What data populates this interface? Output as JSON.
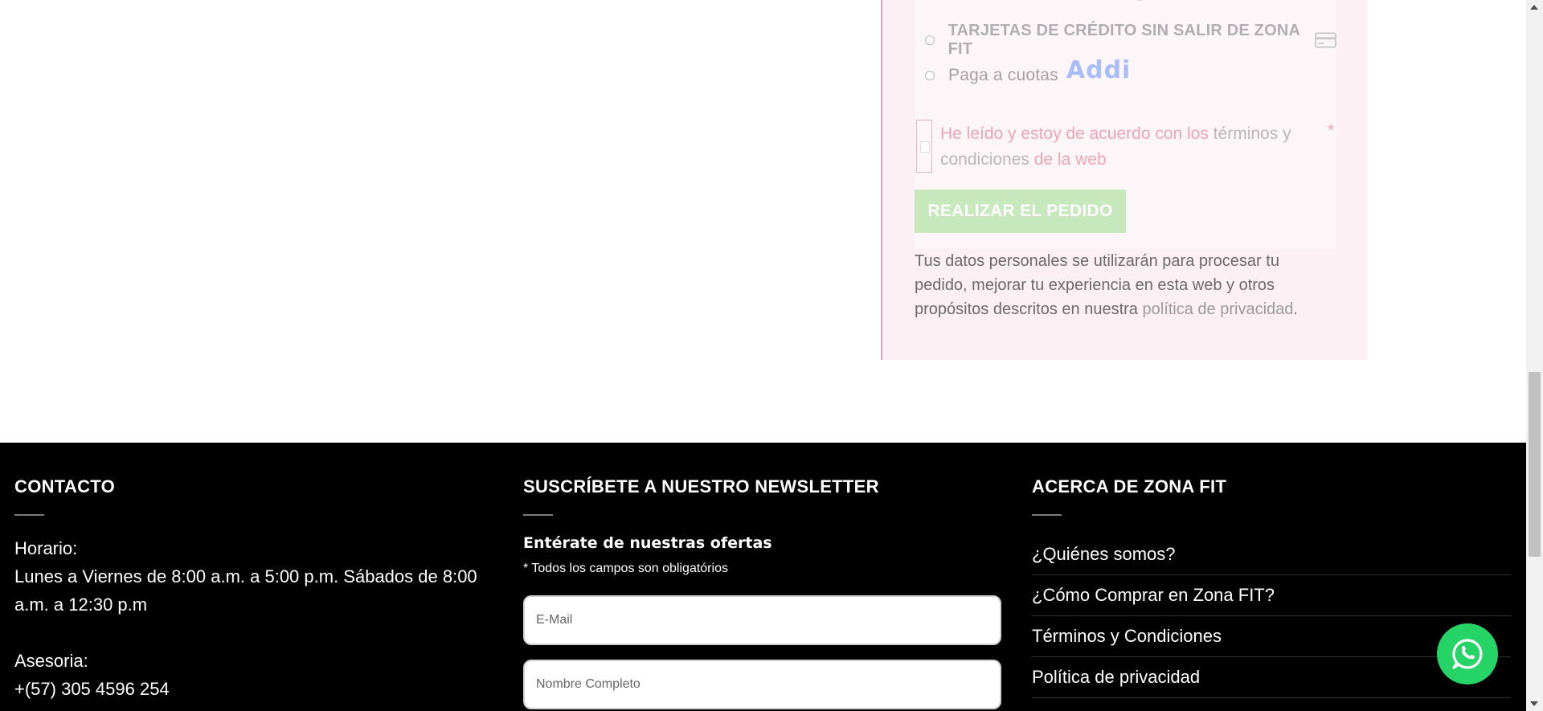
{
  "checkout": {
    "payment_options": [
      {
        "label": "TARJETAS DE CRÉDITO SIN SALIR DE ZONA FIT",
        "icon": "credit-card-icon"
      },
      {
        "label": "Paga a cuotas",
        "icon": "addi-logo",
        "logo_text": "Addi"
      }
    ],
    "terms": {
      "text_before": "He leído y estoy de acuerdo con los ",
      "link_text": "términos y condiciones",
      "text_after": " de la web",
      "required_mark": "*"
    },
    "order_button_label": "REALIZAR EL PEDIDO",
    "privacy": {
      "text_before": "Tus datos personales se utilizarán para procesar tu pedido, mejorar tu experiencia en esta web y otros propósitos descritos en nuestra ",
      "link_text": "política de privacidad",
      "text_after": "."
    }
  },
  "footer": {
    "contact": {
      "title": "CONTACTO",
      "hours_label": "Horario:",
      "hours_text": "Lunes a Viernes de 8:00 a.m. a 5:00 p.m. Sábados de 8:00 a.m. a 12:30 p.m",
      "advice_label": "Asesoria:",
      "phone": "+(57) 305 4596 254"
    },
    "newsletter": {
      "title": "SUSCRÍBETE A NUESTRO NEWSLETTER",
      "heading": "Entérate de nuestras ofertas",
      "note": "* Todos los campos son obligatórios",
      "email_placeholder": "E-Mail",
      "name_placeholder": "Nombre Completo"
    },
    "about": {
      "title": "ACERCA DE ZONA FIT",
      "links": [
        "¿Quiénes somos?",
        "¿Cómo Comprar en Zona FIT?",
        "Términos y Condiciones",
        "Política de privacidad"
      ]
    }
  },
  "whatsapp": {
    "icon": "whatsapp-icon",
    "color": "#25d366"
  },
  "colors": {
    "footer_bg": "#000000",
    "checkout_bg": "#fcf0f5",
    "order_button": "#c7e7bd",
    "required": "#f0a5b5"
  }
}
